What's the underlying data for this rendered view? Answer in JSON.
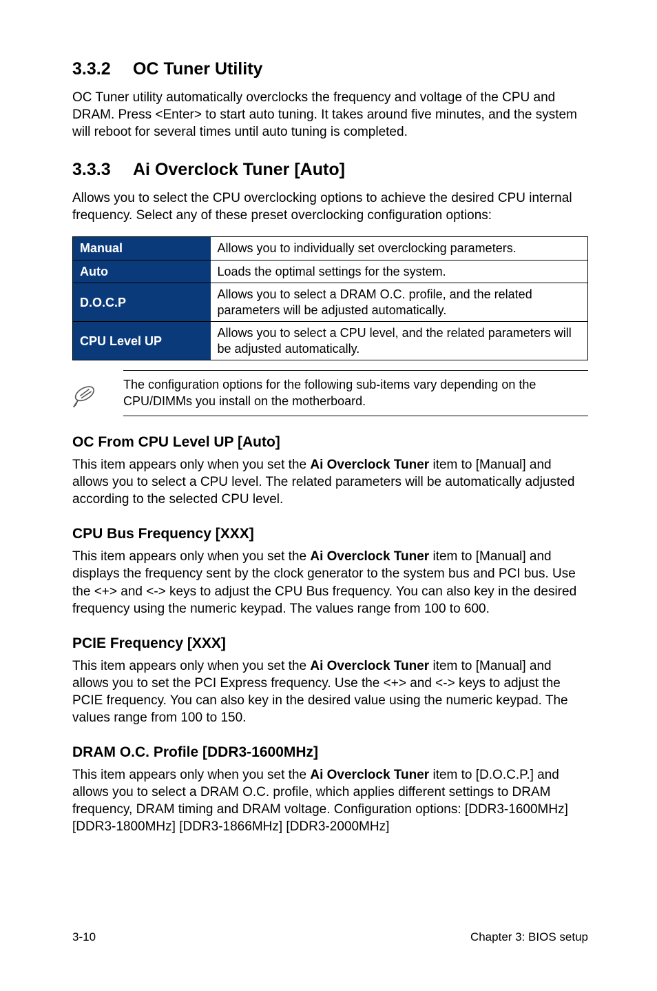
{
  "sections": {
    "oc_tuner": {
      "number": "3.3.2",
      "title": "OC Tuner Utility",
      "body": "OC Tuner utility automatically overclocks the frequency and voltage of the CPU and DRAM. Press <Enter> to start auto tuning. It takes around five minutes, and the system will reboot for several times until auto tuning is completed."
    },
    "ai_oc_tuner": {
      "number": "3.3.3",
      "title": "Ai Overclock Tuner [Auto]",
      "body": "Allows you to select the CPU overclocking options to achieve the desired CPU internal frequency. Select any of these preset overclocking configuration options:",
      "options": {
        "manual": {
          "label": "Manual",
          "desc": "Allows you to individually set overclocking parameters."
        },
        "auto": {
          "label": "Auto",
          "desc": "Loads the optimal settings for the system."
        },
        "docp": {
          "label": "D.O.C.P",
          "desc": "Allows you to select a DRAM O.C. profile, and the related parameters will be adjusted automatically."
        },
        "cpulvl": {
          "label": "CPU Level UP",
          "desc": "Allows you to select a CPU level, and the related parameters will be adjusted automatically."
        }
      },
      "note": "The configuration options for the following sub-items vary depending on the CPU/DIMMs you install on the motherboard."
    },
    "oc_from_cpu": {
      "title": "OC From CPU Level UP [Auto]",
      "body_pre": "This item appears only when you set the ",
      "body_bold": "Ai Overclock Tuner",
      "body_post": " item to [Manual] and allows you to select a CPU level. The related parameters will be automatically adjusted according to the selected CPU level."
    },
    "cpu_bus": {
      "title": "CPU Bus Frequency [XXX]",
      "body_pre": "This item appears only when you set the ",
      "body_bold": "Ai Overclock Tuner",
      "body_post": " item to [Manual] and displays the frequency sent by the clock generator to the system bus and PCI bus. Use the <+> and <-> keys to adjust the CPU Bus frequency. You can also key in the desired frequency using the numeric keypad. The values range from 100 to 600."
    },
    "pcie": {
      "title": "PCIE Frequency [XXX]",
      "body_pre": "This item appears only when you set the ",
      "body_bold": "Ai Overclock Tuner",
      "body_post": " item to [Manual] and allows you to set the PCI Express frequency. Use the <+> and <-> keys to adjust the PCIE frequency. You can also key in the desired value using the numeric keypad. The values range from 100 to 150."
    },
    "dram_oc": {
      "title": "DRAM O.C. Profile [DDR3-1600MHz]",
      "body_pre": "This item appears only when you set the ",
      "body_bold": "Ai Overclock Tuner",
      "body_post": " item to [D.O.C.P.] and allows you to select a DRAM O.C. profile, which applies different settings to DRAM frequency, DRAM timing and DRAM voltage. Configuration options: [DDR3-1600MHz] [DDR3-1800MHz] [DDR3-1866MHz] [DDR3-2000MHz]"
    }
  },
  "footer": {
    "page": "3-10",
    "chapter": "Chapter 3: BIOS setup"
  }
}
